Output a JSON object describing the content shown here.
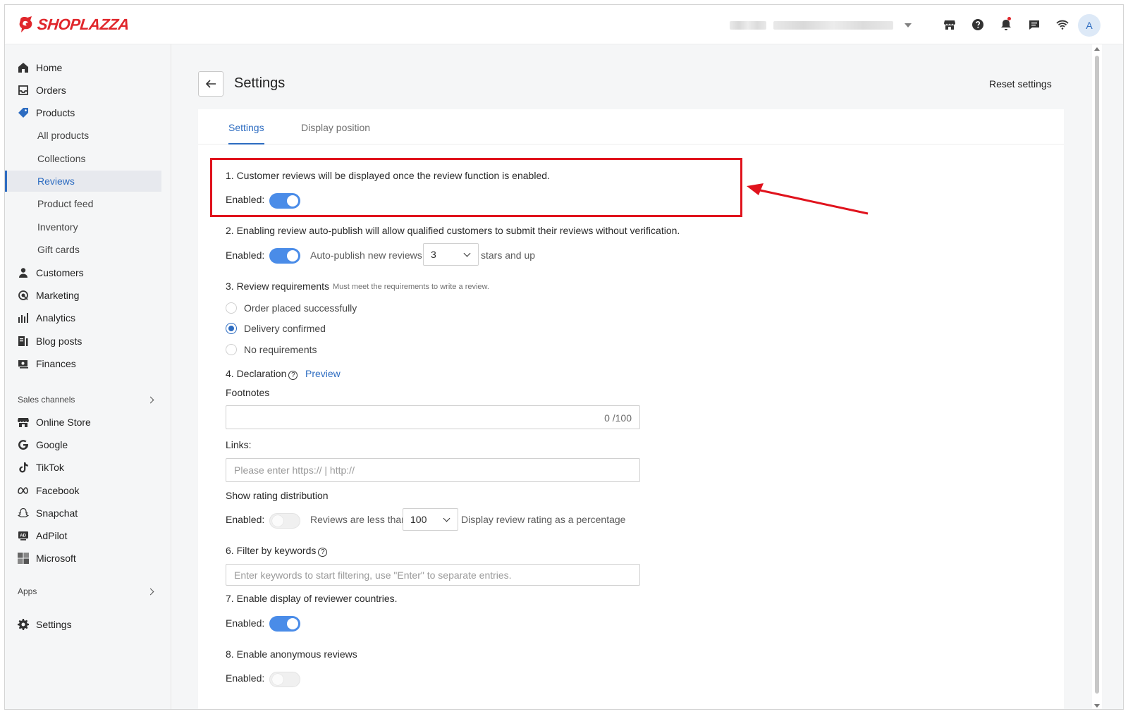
{
  "brand": {
    "logo_text": "SHOPLAZZA",
    "accent": "#e0262b",
    "link_color": "#2d6cc1",
    "toggle_on_color": "#4a8ce8"
  },
  "header": {
    "icons": [
      "store-icon",
      "help-icon",
      "bell-icon",
      "chat-icon",
      "wifi-icon"
    ],
    "avatar_initial": "A"
  },
  "sidebar": {
    "main": [
      {
        "label": "Home",
        "icon": "home-icon"
      },
      {
        "label": "Orders",
        "icon": "inbox-icon"
      },
      {
        "label": "Products",
        "icon": "tag-icon"
      }
    ],
    "products_sub": [
      "All products",
      "Collections",
      "Reviews",
      "Product feed",
      "Inventory",
      "Gift cards"
    ],
    "main2": [
      {
        "label": "Customers",
        "icon": "person-icon"
      },
      {
        "label": "Marketing",
        "icon": "marketing-icon"
      },
      {
        "label": "Analytics",
        "icon": "bar-chart-icon"
      },
      {
        "label": "Blog posts",
        "icon": "blog-icon"
      },
      {
        "label": "Finances",
        "icon": "finance-icon"
      }
    ],
    "sales_channels_label": "Sales channels",
    "channels": [
      {
        "label": "Online Store",
        "icon": "store-icon"
      },
      {
        "label": "Google",
        "icon": "google-icon"
      },
      {
        "label": "TikTok",
        "icon": "tiktok-icon"
      },
      {
        "label": "Facebook",
        "icon": "meta-icon"
      },
      {
        "label": "Snapchat",
        "icon": "snapchat-icon"
      },
      {
        "label": "AdPilot",
        "icon": "adpilot-icon"
      },
      {
        "label": "Microsoft",
        "icon": "microsoft-icon"
      }
    ],
    "apps_label": "Apps",
    "settings_label": "Settings"
  },
  "page": {
    "title": "Settings",
    "reset_label": "Reset settings",
    "tabs": [
      "Settings",
      "Display position"
    ]
  },
  "settings": {
    "s1": {
      "text": "1. Customer reviews will be displayed once the review function is enabled.",
      "enabled_label": "Enabled:",
      "enabled": true
    },
    "s2": {
      "text": "2. Enabling review auto-publish will allow qualified customers to submit their reviews without verification.",
      "enabled_label": "Enabled:",
      "enabled": true,
      "auto_label": "Auto-publish new reviews",
      "stars_value": "3",
      "suffix": "stars and up"
    },
    "s3": {
      "title": "3. Review requirements",
      "hint": "Must meet the requirements to write a review.",
      "options": [
        "Order placed successfully",
        "Delivery confirmed",
        "No requirements"
      ],
      "selected": "Delivery confirmed"
    },
    "s4": {
      "title": "4. Declaration",
      "help_glyph": "?",
      "preview_label": "Preview",
      "footnotes_label": "Footnotes",
      "footnotes_counter": "0 /100",
      "links_label": "Links:",
      "links_placeholder": "Please enter https:// | http://"
    },
    "s5": {
      "title": "Show rating distribution",
      "enabled_label": "Enabled:",
      "enabled": false,
      "less_than_label": "Reviews are less than",
      "threshold_value": "100",
      "suffix": "Display review rating as a percentage"
    },
    "s6": {
      "title": "6. Filter by keywords",
      "help_glyph": "?",
      "placeholder": "Enter keywords to start filtering, use \"Enter\" to separate entries."
    },
    "s7": {
      "text": "7. Enable display of reviewer countries.",
      "enabled_label": "Enabled:",
      "enabled": true
    },
    "s8": {
      "text": "8. Enable anonymous reviews",
      "enabled_label": "Enabled:",
      "enabled": false
    }
  }
}
